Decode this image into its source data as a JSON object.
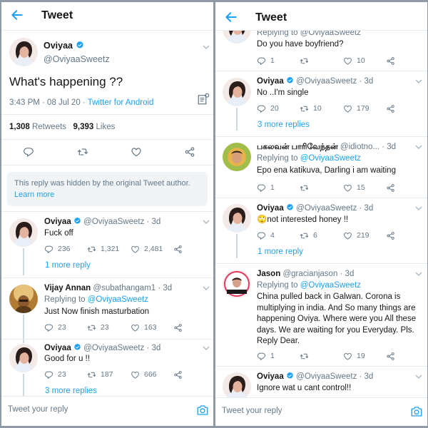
{
  "left": {
    "title": "Tweet",
    "main": {
      "name": "Oviyaa",
      "handle": "@OviyaaSweetz",
      "text": "What's happening ??",
      "time": "3:43 PM · 08 Jul 20 · ",
      "source": "Twitter for Android",
      "retweets": "1,308",
      "retweets_label": " Retweets",
      "likes": "9,393",
      "likes_label": " Likes"
    },
    "hidden_notice": "This reply was hidden by the original Tweet author.",
    "learn_more": "Learn more",
    "replies": [
      {
        "name": "Oviyaa",
        "handle": "@OviyaaSweetz · 3d",
        "text": "Fuck off",
        "reply": "236",
        "rt": "1,321",
        "like": "2,481"
      },
      {
        "name": "Vijay Annan",
        "handle": "@subathangam1 · 3d",
        "replying_to": "Replying to ",
        "replying_handle": "@OviyaaSweetz",
        "text": "Just Now finish masturbation",
        "reply": "23",
        "rt": "23",
        "like": "163"
      },
      {
        "name": "Oviyaa",
        "handle": "@OviyaaSweetz · 3d",
        "text": "Good for u !!",
        "reply": "23",
        "rt": "187",
        "like": "666"
      }
    ],
    "more_replies_1": "1 more reply",
    "more_replies_2": "3 more replies",
    "reply_placeholder": "Tweet your reply"
  },
  "right": {
    "title": "Tweet",
    "top_partial": {
      "replying": "Replying to @OviyaaSweetz",
      "text": "Do you have boyfriend?",
      "reply": "1",
      "rt": "",
      "like": "10"
    },
    "replies": [
      {
        "name": "Oviyaa",
        "handle": "@OviyaaSweetz · 3d",
        "text": "No ..I'm single",
        "reply": "20",
        "rt": "10",
        "like": "179"
      },
      {
        "name": "பகலவன் பாரிவேந்தன்",
        "handle": "@idiotno... · 3d",
        "replying_to": "Replying to ",
        "replying_handle": "@OviyaaSweetz",
        "text": "Epo ena katikuva, Darling i am waiting",
        "reply": "1",
        "rt": "",
        "like": "15"
      },
      {
        "name": "Oviyaa",
        "handle": "@OviyaaSweetz · 3d",
        "text": "not interested honey !!",
        "emoji": "🙄",
        "reply": "4",
        "rt": "6",
        "like": "219"
      },
      {
        "name": "Jason",
        "handle": "@gracianjason · 3d",
        "replying_to": "Replying to ",
        "replying_handle": "@OviyaaSweetz",
        "text_lines": [
          "China pulled back in Galwan. Corona is",
          "multiplying in india. And So many things are",
          "happening Oviya. Where were you All these",
          "days. We are waiting for you Everyday. Pls.",
          "Reply Dear."
        ],
        "reply": "1",
        "rt": "",
        "like": "19"
      },
      {
        "name": "Oviyaa",
        "handle": "@OviyaaSweetz · 3d",
        "text": "Ignore wat u cant control!!"
      }
    ],
    "more_replies_1": "3 more replies",
    "more_replies_2": "1 more reply",
    "reply_placeholder": "Tweet your reply"
  },
  "colors": {
    "accent": "#1da1f2",
    "text": "#14171a",
    "secondary": "#657786",
    "border": "#e6ecf0"
  }
}
